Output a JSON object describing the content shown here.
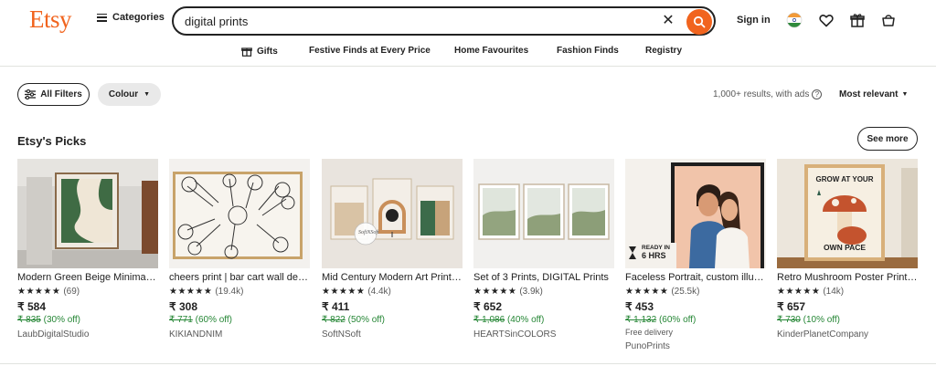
{
  "header": {
    "logo": "Etsy",
    "categories_label": "Categories",
    "search_value": "digital prints",
    "sign_in": "Sign in",
    "accent": "#f1641e"
  },
  "subnav": [
    "Gifts",
    "Festive Finds at Every Price",
    "Home Favourites",
    "Fashion Finds",
    "Registry"
  ],
  "filters": {
    "all_filters": "All Filters",
    "colour": "Colour",
    "results": "1,000+ results, with ads",
    "sort": "Most relevant"
  },
  "picks": {
    "title": "Etsy's Picks",
    "see_more": "See more",
    "items": [
      {
        "title": "Modern Green Beige Minimal Art Print",
        "reviews": "(69)",
        "price": "₹ 584",
        "original": "₹ 835",
        "discount": "(30% off)",
        "shop": "LaubDigitalStudio",
        "free_delivery": ""
      },
      {
        "title": "cheers print | bar cart wall decor",
        "reviews": "(19.4k)",
        "price": "₹ 308",
        "original": "₹ 771",
        "discount": "(60% off)",
        "shop": "KIKIANDNIM",
        "free_delivery": ""
      },
      {
        "title": "Mid Century Modern Art Print Set",
        "reviews": "(4.4k)",
        "price": "₹ 411",
        "original": "₹ 822",
        "discount": "(50% off)",
        "shop": "SoftNSoft",
        "free_delivery": ""
      },
      {
        "title": "Set of 3 Prints, DIGITAL Prints",
        "reviews": "(3.9k)",
        "price": "₹ 652",
        "original": "₹ 1,086",
        "discount": "(40% off)",
        "shop": "HEARTSinCOLORS",
        "free_delivery": ""
      },
      {
        "title": "Faceless Portrait, custom illustration",
        "reviews": "(25.5k)",
        "price": "₹ 453",
        "original": "₹ 1,132",
        "discount": "(60% off)",
        "shop": "PunoPrints",
        "free_delivery": "Free delivery"
      },
      {
        "title": "Retro Mushroom Poster Print, Grow",
        "reviews": "(14k)",
        "price": "₹ 657",
        "original": "₹ 730",
        "discount": "(10% off)",
        "shop": "KinderPlanetCompany",
        "free_delivery": ""
      }
    ],
    "stars": "★★★★★"
  },
  "poster_text": {
    "ready": "READY IN",
    "hrs": "6 HRS",
    "grow": "GROW AT YOUR",
    "own_pace": "OWN PACE",
    "softnsoft_sig": "SoftNSoft"
  }
}
